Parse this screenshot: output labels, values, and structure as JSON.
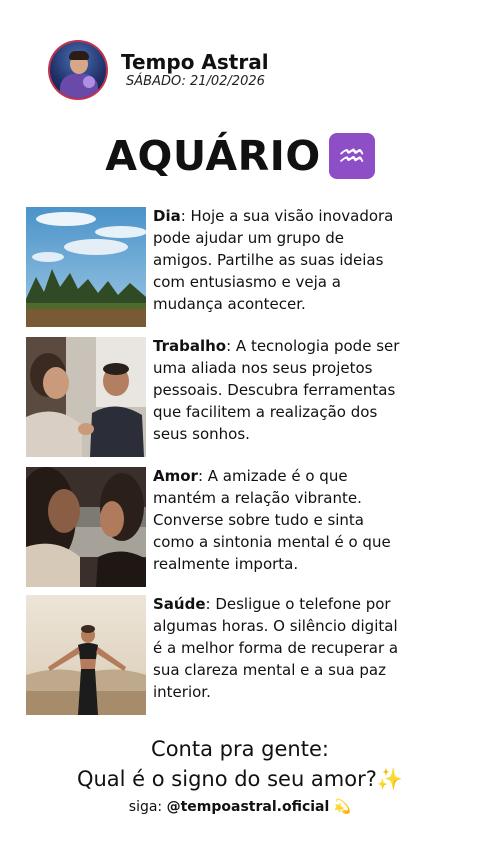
{
  "header": {
    "brand_name": "Tempo Astral",
    "date": "SÁBADO: 21/02/2026",
    "avatar_icon": "astrologer-avatar"
  },
  "sign": {
    "name": "AQUÁRIO",
    "symbol": "♒",
    "symbol_color": "#8e4ec6"
  },
  "sections": [
    {
      "title": "Dia",
      "text": ": Hoje a sua visão inovadora pode ajudar um grupo de amigos. Partilhe as suas ideias com entusiasmo e veja a mudança acontecer.",
      "image": "sky-trees-photo"
    },
    {
      "title": "Trabalho",
      "text": ": A tecnologia pode ser uma aliada nos seus projetos pessoais. Descubra ferramentas que facilitem a realização dos seus sonhos.",
      "image": "coworkers-meeting-photo"
    },
    {
      "title": "Amor",
      "text": ": A amizade é o que mantém a relação vibrante. Converse sobre tudo e sinta como a sintonia mental é o que realmente importa.",
      "image": "couple-seaside-photo"
    },
    {
      "title": "Saúde",
      "text": ": Desligue o telefone por algumas horas. O silêncio digital é a melhor forma de recuperar a sua clareza mental e a sua paz interior.",
      "image": "woman-exercising-outdoors-photo"
    }
  ],
  "cta": {
    "line1": "Conta pra gente:",
    "line2": "Qual é o signo do seu amor?",
    "line2_emoji": "✨"
  },
  "follow": {
    "prefix": "siga: ",
    "handle": "@tempoastral.oficial",
    "emoji": "💫"
  }
}
